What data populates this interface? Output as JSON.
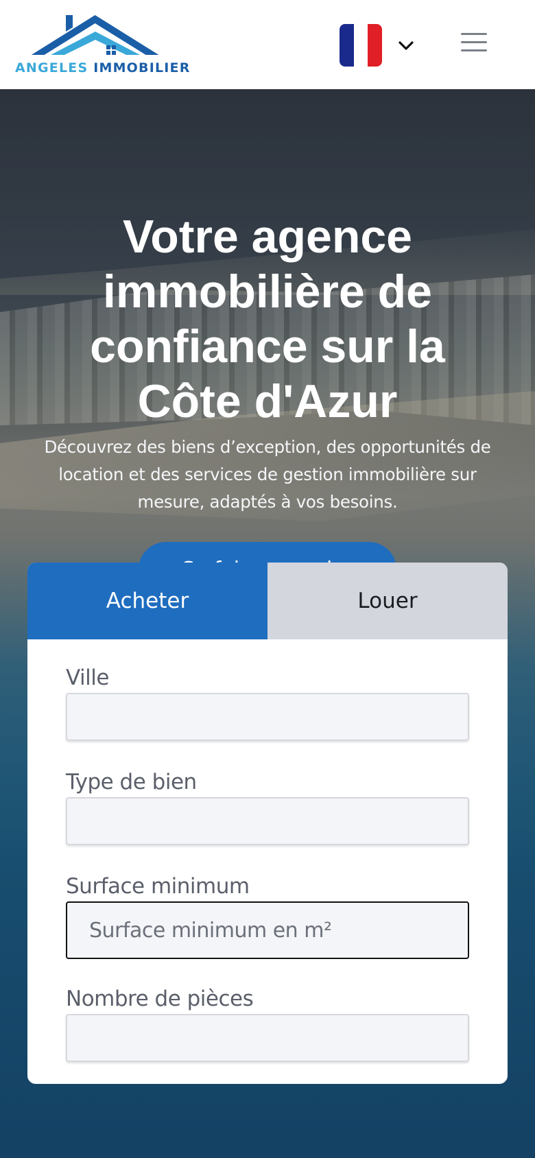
{
  "header": {
    "logo": {
      "word1": "ANGELES",
      "word2": "IMMOBILIER"
    },
    "language": {
      "flag": "fr-flag-icon",
      "colors": [
        "#1a2a8c",
        "#ffffff",
        "#e01f26"
      ]
    },
    "menu_icon": "hamburger-menu-icon"
  },
  "hero": {
    "title": "Votre agence immobilière de confiance sur la Côte d'Azur",
    "subtitle": "Découvrez des biens d’exception, des opportunités de location et des services de gestion immobilière sur mesure, adaptés à vos besoins.",
    "cta_label": "Se faire rappeler"
  },
  "search": {
    "tabs": [
      {
        "label": "Acheter",
        "active": true
      },
      {
        "label": "Louer",
        "active": false
      }
    ],
    "fields": {
      "city": {
        "label": "Ville",
        "value": ""
      },
      "property_type": {
        "label": "Type de bien",
        "value": ""
      },
      "min_surface": {
        "label": "Surface minimum",
        "placeholder": "Surface minimum en m²"
      },
      "rooms": {
        "label": "Nombre de pièces",
        "value": ""
      }
    }
  },
  "colors": {
    "primary": "#1f6dbf",
    "logo_light": "#3aa8d8",
    "logo_dark": "#1b5ea8"
  }
}
